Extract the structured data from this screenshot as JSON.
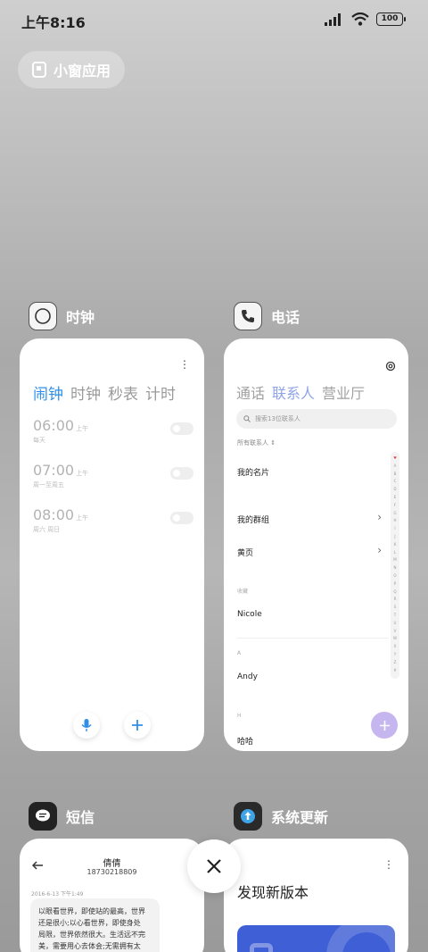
{
  "status_bar": {
    "time": "上午8:16",
    "battery": "100"
  },
  "floating_window": {
    "label": "小窗应用"
  },
  "apps": {
    "clock": {
      "name": "时钟",
      "tabs": [
        "闹钟",
        "时钟",
        "秒表",
        "计时"
      ],
      "alarms": [
        {
          "time": "06:00",
          "ampm": "上午",
          "repeat": "每天"
        },
        {
          "time": "07:00",
          "ampm": "上午",
          "repeat": "周一至周五"
        },
        {
          "time": "08:00",
          "ampm": "上午",
          "repeat": "周六 周日"
        }
      ]
    },
    "phone": {
      "name": "电话",
      "tabs": [
        "通话",
        "联系人",
        "营业厅"
      ],
      "search_placeholder": "搜索13位联系人",
      "filter_label": "所有联系人",
      "my_card": "我的名片",
      "my_groups": "我的群组",
      "yellow_pages": "黄页",
      "favorites_label": "收藏",
      "favorite_contact": "Nicole",
      "section_a": "A",
      "contact_a": "Andy",
      "section_h": "H",
      "contact_h": "哈哈",
      "index_letters": [
        "♥",
        "A",
        "B",
        "C",
        "D",
        "E",
        "F",
        "G",
        "H",
        "I",
        "J",
        "K",
        "L",
        "M",
        "N",
        "O",
        "P",
        "Q",
        "R",
        "S",
        "T",
        "U",
        "V",
        "W",
        "X",
        "Y",
        "Z",
        "#"
      ]
    },
    "sms": {
      "name": "短信",
      "contact_name": "倩倩",
      "contact_number": "18730218809",
      "timestamp": "2016-6-13 下午1:49",
      "message_lines": [
        "以眼看世界，即使站的最高，世界",
        "还是很小;以心看世界，即使身处",
        "局限，世界依然很大。生活远不完",
        "美，需要用心去体会;无需拥有太"
      ]
    },
    "update": {
      "name": "系统更新",
      "headline": "发现新版本"
    }
  },
  "colors": {
    "clock_accent": "#2f8fe8",
    "phone_accent": "#8fa4e6",
    "fab": "#c6b6ef",
    "update_banner": "#3f5fd6"
  }
}
